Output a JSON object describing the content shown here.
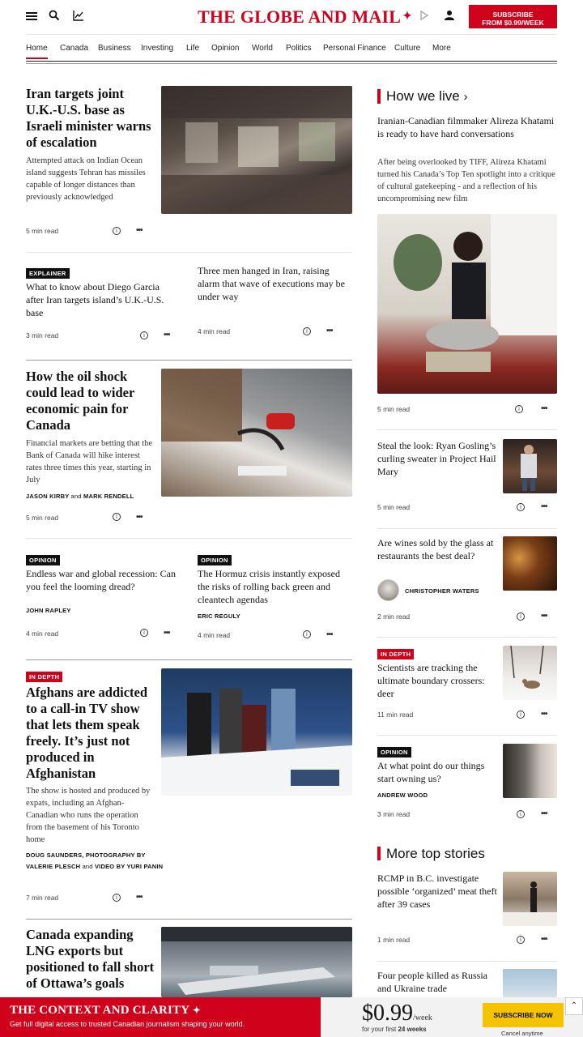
{
  "header": {
    "logo": "THE GLOBE AND MAIL",
    "subscribe_line1": "SUBSCRIBE",
    "subscribe_line2": "FROM $0.99/WEEK",
    "icons": [
      "hamburger-menu-icon",
      "search-icon",
      "chart-icon",
      "play-icon",
      "user-icon"
    ],
    "brand_color": "#d0021b"
  },
  "nav": {
    "items": [
      "Home",
      "Canada",
      "Business",
      "Investing",
      "Life",
      "Opinion",
      "World",
      "Politics",
      "Personal Finance",
      "Culture",
      "More"
    ],
    "active": "Home"
  },
  "main": {
    "story1": {
      "title": "Iran targets joint U.K.-U.S. base as Israeli minister warns of escalation",
      "dek": "Attempted attack on Indian Ocean island suggests Tehran has missiles capable of longer distances than previously acknowledged",
      "read": "5 min read"
    },
    "story2": {
      "label": "EXPLAINER",
      "title": "What to know about Diego Garcia after Iran targets island’s U.K.-U.S. base",
      "read": "3 min read"
    },
    "story3": {
      "title": "Three men hanged in Iran, raising alarm that wave of executions may be under way",
      "read": "4 min read"
    },
    "story4": {
      "title": "How the oil shock could lead to wider economic pain for Canada",
      "dek": "Financial markets are betting that the Bank of Canada will hike interest rates three times this year, starting in July",
      "author1": "JASON KIRBY",
      "and": "and",
      "author2": "MARK RENDELL",
      "read": "5 min read"
    },
    "story5": {
      "label": "OPINION",
      "title": "Endless war and global recession: Can you feel the looming dread?",
      "author": "JOHN RAPLEY",
      "read": "4 min read"
    },
    "story6": {
      "label": "OPINION",
      "title": "The Hormuz crisis instantly exposed the risks of rolling back green and cleantech agendas",
      "author": "ERIC REGULY",
      "read": "4 min read"
    },
    "story7": {
      "label": "IN DEPTH",
      "title": "Afghans are addicted to a call-in TV show that lets them speak freely. It’s just not produced in Afghanistan",
      "dek": "The show is hosted and produced by expats, including an Afghan-Canadian who runs the operation from the basement of his Toronto home",
      "byline_a": "DOUG SAUNDERS",
      "byline_b": ", PHOTOGRAPHY BY",
      "byline_c": "VALERIE PLESCH",
      "byline_and": "and",
      "byline_d": "VIDEO BY YURI",
      "byline_e": "PANIN",
      "read": "7 min read"
    },
    "story8": {
      "title": "Canada expanding LNG exports but positioned to fall short of Ottawa’s goals"
    }
  },
  "sidebar": {
    "how_we_live": {
      "title": "How we live",
      "lead_title": "Iranian-Canadian filmmaker Alireza Khatami is ready to have hard conversations",
      "lead_dek": "After being overlooked by TIFF, Alireza Khatami turned his Canada’s Top Ten spotlight into a critique of cultural gatekeeping - and a reflection of his uncompromising new film",
      "lead_read": "5 min read",
      "items": [
        {
          "title": "Steal the look: Ryan Gosling’s curling sweater in Project Hail Mary",
          "read": "5 min read"
        },
        {
          "title": "Are wines sold by the glass at restaurants the best deal?",
          "author": "CHRISTOPHER WATERS",
          "read": "2 min read"
        },
        {
          "label": "IN DEPTH",
          "title": "Scientists are tracking the ultimate boundary crossers: deer",
          "read": "11 min read"
        },
        {
          "label": "OPINION",
          "title": "At what point do our things start owning us?",
          "author": "ANDREW WOOD",
          "read": "3 min read"
        }
      ]
    },
    "more_top": {
      "title": "More top stories",
      "items": [
        {
          "title": "RCMP in B.C. investigate possible ‘organized’ meat theft after 39 cases",
          "read": "1 min read"
        },
        {
          "title": "Four people killed as Russia and Ukraine trade"
        }
      ]
    }
  },
  "promo": {
    "title": "THE CONTEXT AND CLARITY",
    "subtitle": "Get full digital access to trusted Canadian journalism shaping your world.",
    "price": "$0.99",
    "unit": "/week",
    "first_prefix": "for your first",
    "first_weeks": "24 weeks",
    "button": "SUBSCRIBE NOW",
    "cancel": "Cancel anytime"
  }
}
